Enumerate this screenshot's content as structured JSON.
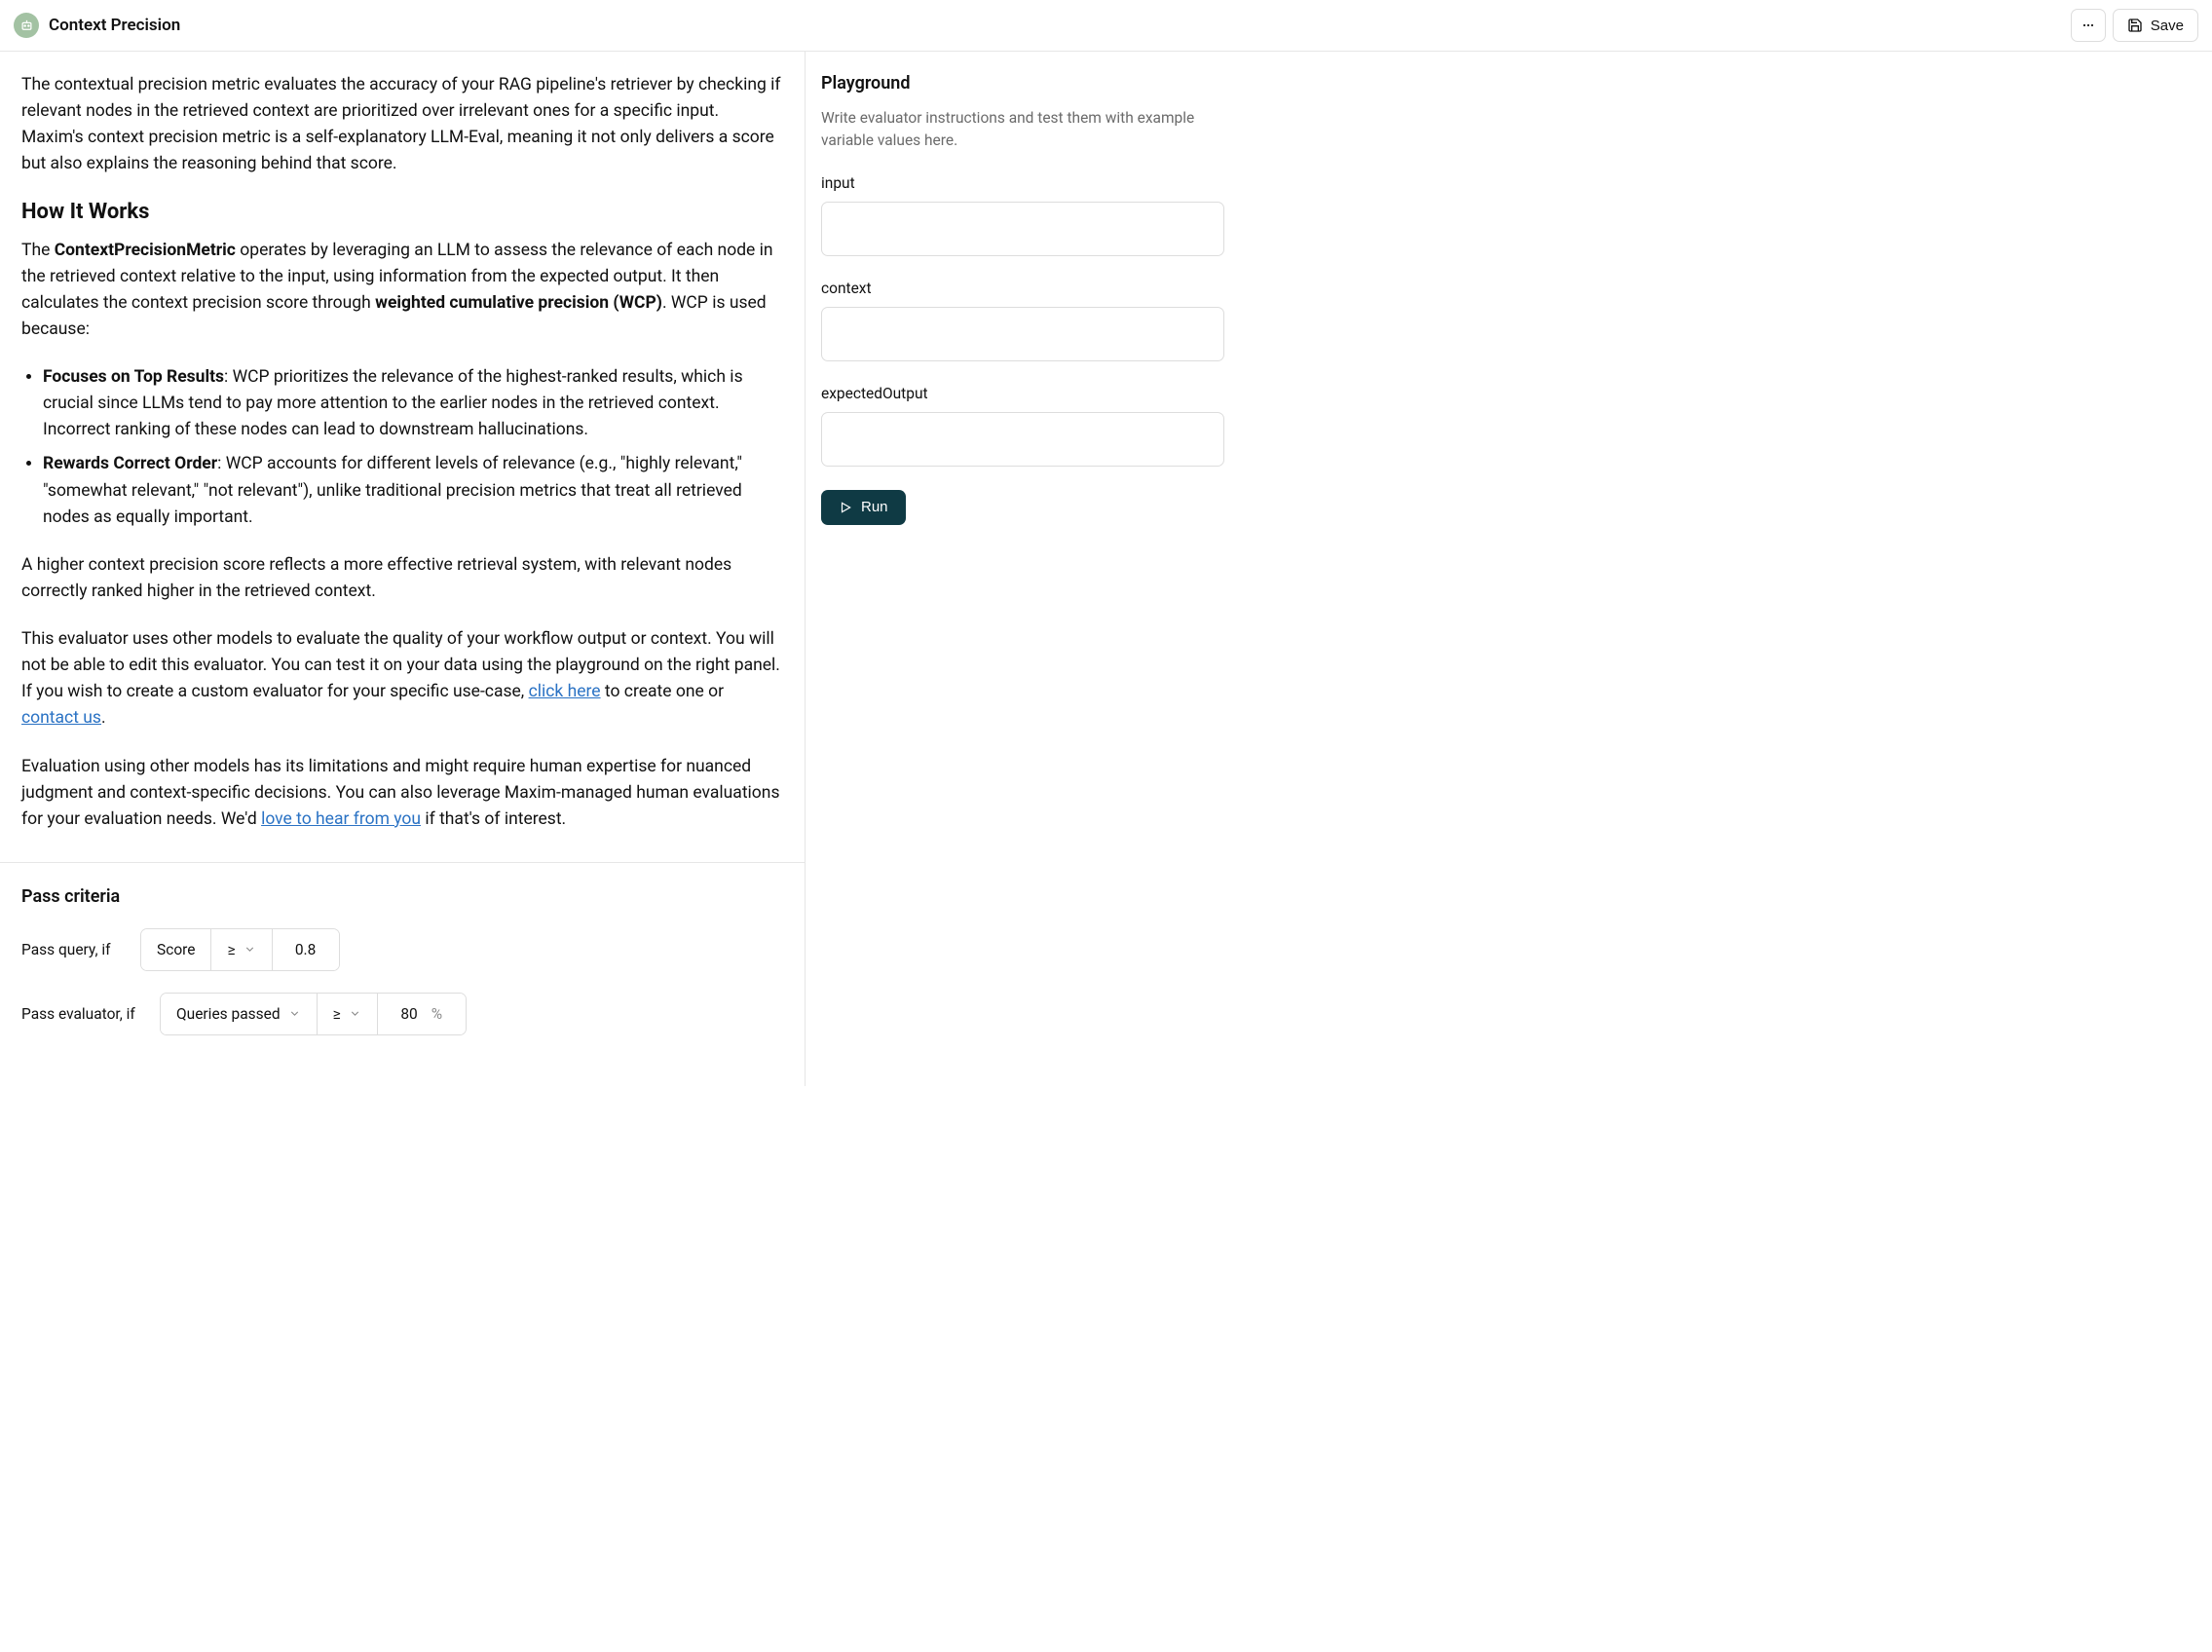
{
  "header": {
    "title": "Context Precision",
    "save_label": "Save"
  },
  "content": {
    "intro": "The contextual precision metric evaluates the accuracy of your RAG pipeline's retriever by checking if relevant nodes in the retrieved context are prioritized over irrelevant ones for a specific input. Maxim's context precision metric is a self-explanatory LLM-Eval, meaning it not only delivers a score but also explains the reasoning behind that score.",
    "how_heading": "How It Works",
    "p1_pre": "The ",
    "p1_bold1": "ContextPrecisionMetric",
    "p1_mid": " operates by leveraging an LLM to assess the relevance of each node in the retrieved context relative to the input, using information from the expected output. It then calculates the context precision score through ",
    "p1_bold2": "weighted cumulative precision (WCP)",
    "p1_post": ". WCP is used because:",
    "bullet1_bold": "Focuses on Top Results",
    "bullet1_rest": ": WCP prioritizes the relevance of the highest-ranked results, which is crucial since LLMs tend to pay more attention to the earlier nodes in the retrieved context. Incorrect ranking of these nodes can lead to downstream hallucinations.",
    "bullet2_bold": "Rewards Correct Order",
    "bullet2_rest": ": WCP accounts for different levels of relevance (e.g., \"highly relevant,\" \"somewhat relevant,\" \"not relevant\"), unlike traditional precision metrics that treat all retrieved nodes as equally important.",
    "p2": "A higher context precision score reflects a more effective retrieval system, with relevant nodes correctly ranked higher in the retrieved context.",
    "p3_pre": "This evaluator uses other models to evaluate the quality of your workflow output or context. You will not be able to edit this evaluator. You can test it on your data using the playground on the right panel. If you wish to create a custom evaluator for your specific use-case, ",
    "p3_link1": "click here",
    "p3_mid": " to create one or ",
    "p3_link2": "contact us",
    "p3_end": ".",
    "p4_pre": "Evaluation using other models has its limitations and might require human expertise for nuanced judgment and context-specific decisions. You can also leverage Maxim-managed human evaluations for your evaluation needs. We'd ",
    "p4_link": "love to hear from you",
    "p4_end": " if that's of interest."
  },
  "pass": {
    "heading": "Pass criteria",
    "query_label": "Pass query, if",
    "query_metric": "Score",
    "query_op": "≥",
    "query_val": "0.8",
    "eval_label": "Pass evaluator, if",
    "eval_metric": "Queries passed",
    "eval_op": "≥",
    "eval_val": "80",
    "eval_unit": "%"
  },
  "playground": {
    "title": "Playground",
    "desc": "Write evaluator instructions and test them with example variable values here.",
    "input_label": "input",
    "context_label": "context",
    "expected_label": "expectedOutput",
    "run_label": "Run"
  }
}
